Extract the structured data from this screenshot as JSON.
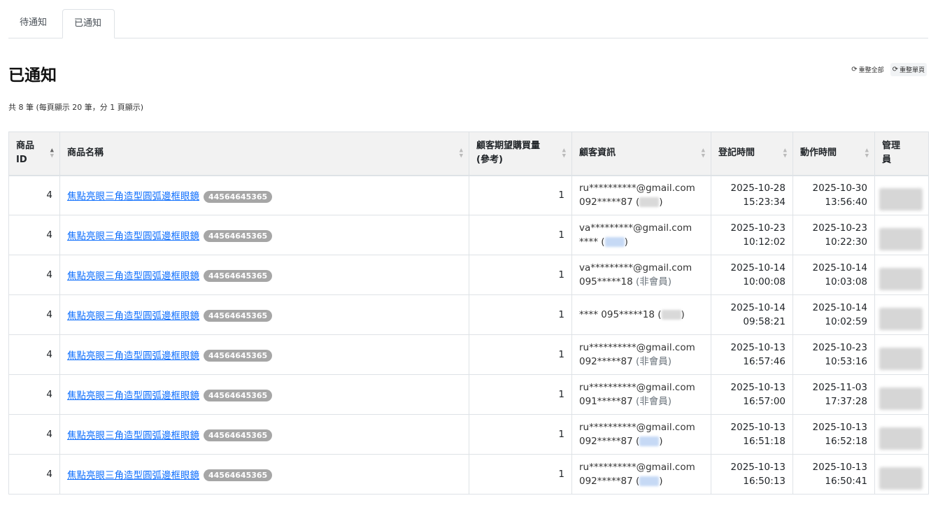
{
  "tabs": [
    {
      "label": "待通知"
    },
    {
      "label": "已通知"
    }
  ],
  "page_title": "已通知",
  "buttons": {
    "reload_all": "重整全部",
    "reload_page": "重整單頁"
  },
  "summary": "共 8 筆 (每頁顯示 20 筆，分 1 頁顯示)",
  "columns": [
    "商品\nID",
    "商品名稱",
    "顧客期望購買量\n(參考)",
    "顧客資訊",
    "登記時間",
    "動作時間",
    "管理\n員"
  ],
  "rows": [
    {
      "id": "4",
      "name": "焦點亮眼三角造型圓弧邊框眼鏡",
      "sku": "44564645365",
      "qty": "1",
      "email": "ru**********@gmail.com",
      "phone": "092*****87 (",
      "phone_tail": ")",
      "member": "",
      "reg_date": "2025-10-28",
      "reg_time": "15:23:34",
      "act_date": "2025-10-30",
      "act_time": "13:56:40"
    },
    {
      "id": "4",
      "name": "焦點亮眼三角造型圓弧邊框眼鏡",
      "sku": "44564645365",
      "qty": "1",
      "email": "va*********@gmail.com",
      "phone": "**** (",
      "phone_tail": ")",
      "member": "",
      "reg_date": "2025-10-23",
      "reg_time": "10:12:02",
      "act_date": "2025-10-23",
      "act_time": "10:22:30"
    },
    {
      "id": "4",
      "name": "焦點亮眼三角造型圓弧邊框眼鏡",
      "sku": "44564645365",
      "qty": "1",
      "email": "va*********@gmail.com",
      "phone": "095*****18",
      "phone_tail": "",
      "member": "(非會員)",
      "reg_date": "2025-10-14",
      "reg_time": "10:00:08",
      "act_date": "2025-10-14",
      "act_time": "10:03:08"
    },
    {
      "id": "4",
      "name": "焦點亮眼三角造型圓弧邊框眼鏡",
      "sku": "44564645365",
      "qty": "1",
      "email": "",
      "phone": "**** 095*****18 (",
      "phone_tail": ")",
      "member": "",
      "reg_date": "2025-10-14",
      "reg_time": "09:58:21",
      "act_date": "2025-10-14",
      "act_time": "10:02:59"
    },
    {
      "id": "4",
      "name": "焦點亮眼三角造型圓弧邊框眼鏡",
      "sku": "44564645365",
      "qty": "1",
      "email": "ru**********@gmail.com",
      "phone": "092*****87",
      "phone_tail": "",
      "member": "(非會員)",
      "reg_date": "2025-10-13",
      "reg_time": "16:57:46",
      "act_date": "2025-10-23",
      "act_time": "10:53:16"
    },
    {
      "id": "4",
      "name": "焦點亮眼三角造型圓弧邊框眼鏡",
      "sku": "44564645365",
      "qty": "1",
      "email": "ru**********@gmail.com",
      "phone": "091*****87",
      "phone_tail": "",
      "member": "(非會員)",
      "reg_date": "2025-10-13",
      "reg_time": "16:57:00",
      "act_date": "2025-11-03",
      "act_time": "17:37:28"
    },
    {
      "id": "4",
      "name": "焦點亮眼三角造型圓弧邊框眼鏡",
      "sku": "44564645365",
      "qty": "1",
      "email": "ru**********@gmail.com",
      "phone": "092*****87 (",
      "phone_tail": ")",
      "member": "",
      "reg_date": "2025-10-13",
      "reg_time": "16:51:18",
      "act_date": "2025-10-13",
      "act_time": "16:52:18"
    },
    {
      "id": "4",
      "name": "焦點亮眼三角造型圓弧邊框眼鏡",
      "sku": "44564645365",
      "qty": "1",
      "email": "ru**********@gmail.com",
      "phone": "092*****87 (",
      "phone_tail": ")",
      "member": "",
      "reg_date": "2025-10-13",
      "reg_time": "16:50:13",
      "act_date": "2025-10-13",
      "act_time": "16:50:41"
    }
  ],
  "icons": {
    "reload": "refresh-icon",
    "sort": "sort-icon"
  },
  "colors": {
    "link": "#0d6efd",
    "badge": "#a6a6a6",
    "header_bg": "#f2f2f2"
  }
}
